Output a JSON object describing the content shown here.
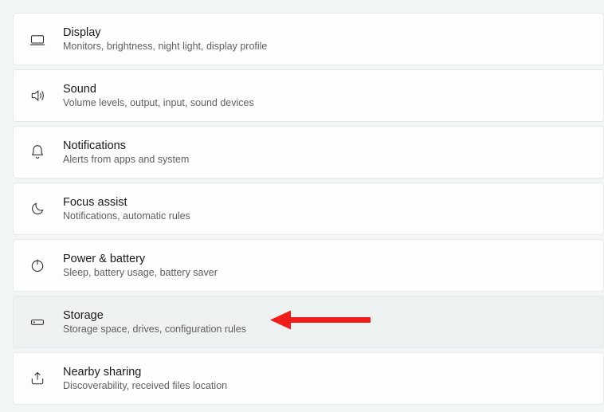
{
  "items": [
    {
      "key": "display",
      "title": "Display",
      "desc": "Monitors, brightness, night light, display profile",
      "highlighted": false
    },
    {
      "key": "sound",
      "title": "Sound",
      "desc": "Volume levels, output, input, sound devices",
      "highlighted": false
    },
    {
      "key": "notifications",
      "title": "Notifications",
      "desc": "Alerts from apps and system",
      "highlighted": false
    },
    {
      "key": "focus-assist",
      "title": "Focus assist",
      "desc": "Notifications, automatic rules",
      "highlighted": false
    },
    {
      "key": "power-battery",
      "title": "Power & battery",
      "desc": "Sleep, battery usage, battery saver",
      "highlighted": false
    },
    {
      "key": "storage",
      "title": "Storage",
      "desc": "Storage space, drives, configuration rules",
      "highlighted": true
    },
    {
      "key": "nearby-sharing",
      "title": "Nearby sharing",
      "desc": "Discoverability, received files location",
      "highlighted": false
    }
  ]
}
